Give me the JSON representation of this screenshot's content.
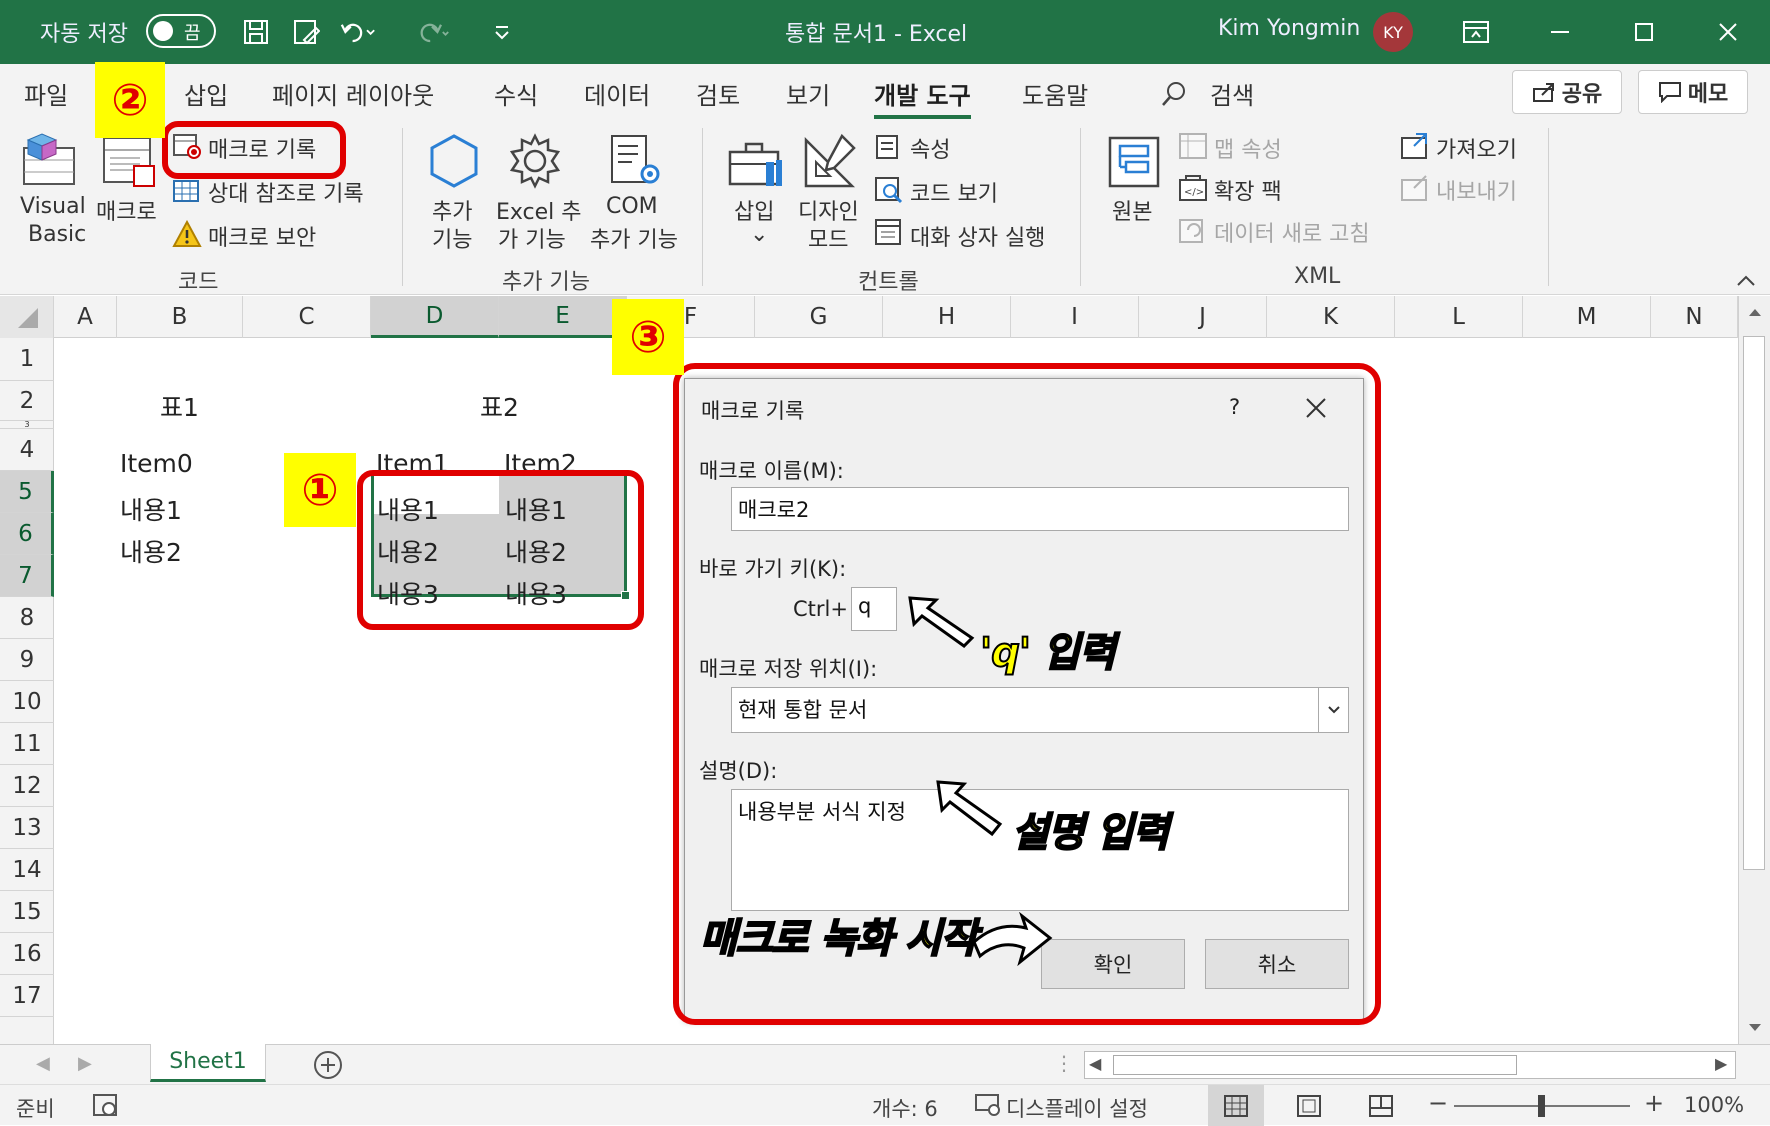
{
  "titlebar": {
    "autosave_label": "자동 저장",
    "autosave_state": "끔",
    "doc_title": "통합 문서1  -  Excel",
    "user_name": "Kim Yongmin",
    "user_initials": "KY"
  },
  "menu": {
    "items": [
      "파일",
      "삽입",
      "페이지 레이아웃",
      "수식",
      "데이터",
      "검토",
      "보기",
      "개발 도구",
      "도움말"
    ],
    "active": "개발 도구",
    "search_label": "검색",
    "share_label": "공유",
    "memo_label": "메모"
  },
  "ribbon": {
    "code": {
      "visual_basic_1": "Visual",
      "visual_basic_2": "Basic",
      "macro": "매크로",
      "record_macro": "매크로 기록",
      "relative_ref": "상대 참조로 기록",
      "macro_security": "매크로 보안",
      "group_label": "코드"
    },
    "addins": {
      "add_1": "추가",
      "add_2": "기능",
      "excel_1": "Excel 추",
      "excel_2": "가 기능",
      "com_1": "COM",
      "com_2": "추가 기능",
      "group_label": "추가 기능"
    },
    "controls": {
      "insert": "삽입",
      "insert_caret": "⌄",
      "design_1": "디자인",
      "design_2": "모드",
      "properties": "속성",
      "view_code": "코드 보기",
      "run_dialog": "대화 상자 실행",
      "group_label": "컨트롤"
    },
    "xml": {
      "source": "원본",
      "map_props": "맵 속성",
      "expansion": "확장 팩",
      "refresh": "데이터 새로 고침",
      "import": "가져오기",
      "export": "내보내기",
      "group_label": "XML"
    }
  },
  "sheet": {
    "columns": [
      "A",
      "B",
      "C",
      "D",
      "E",
      "F",
      "G",
      "H",
      "I",
      "J",
      "K",
      "L",
      "M",
      "N"
    ],
    "rows": [
      "1",
      "2",
      "3",
      "4",
      "5",
      "6",
      "7",
      "8",
      "9",
      "10",
      "11",
      "12",
      "13",
      "14",
      "15",
      "16",
      "17"
    ],
    "cells": {
      "b2": "표1",
      "d2": "표2",
      "b4": "Item0",
      "d4": "Item1",
      "e4": "Item2",
      "b5": "내용1",
      "b6": "내용2",
      "d5": "내용1",
      "e5": "내용1",
      "d6": "내용2",
      "e6": "내용2",
      "d7": "내용3",
      "e7": "내용3"
    },
    "tab": "Sheet1"
  },
  "dialog": {
    "title": "매크로 기록",
    "help": "?",
    "macro_name_label": "매크로 이름(M):",
    "macro_name_value": "매크로2",
    "shortcut_label": "바로 가기 키(K):",
    "ctrl_label": "Ctrl+",
    "shortcut_value": "q",
    "store_label": "매크로 저장 위치(I):",
    "store_value": "현재 통합 문서",
    "desc_label": "설명(D):",
    "desc_value": "내용부분 서식 지정",
    "ok": "확인",
    "cancel": "취소"
  },
  "annotations": {
    "step1": "①",
    "step2": "②",
    "step3": "③",
    "q_input": "'q' 입력",
    "desc_input": "설명 입력",
    "start_record": "매크로 녹화 시작"
  },
  "status": {
    "ready": "준비",
    "count": "개수: 6",
    "display": "디스플레이 설정",
    "zoom": "100%"
  },
  "colors": {
    "excel_green": "#217346",
    "highlight_red": "#e00000",
    "highlight_yellow": "#ffff00"
  }
}
